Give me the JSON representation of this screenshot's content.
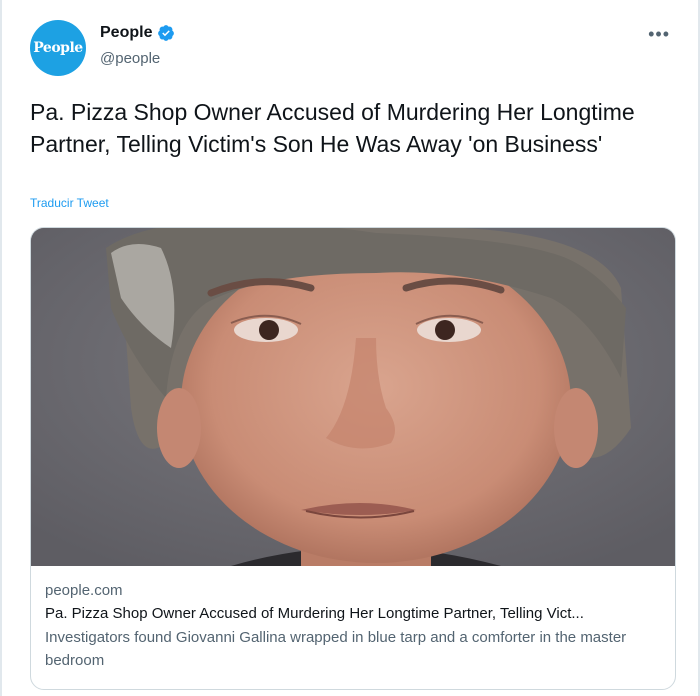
{
  "account": {
    "name": "People",
    "handle": "@people",
    "avatar_text": "People",
    "verified": true
  },
  "more_icon": "more-horizontal-icon",
  "tweet": {
    "text": "Pa. Pizza Shop Owner Accused of Murdering Her Longtime Partner, Telling Victim's Son He Was Away 'on Business'",
    "translate_label": "Traducir Tweet"
  },
  "card": {
    "domain": "people.com",
    "title": "Pa. Pizza Shop Owner Accused of Murdering Her Longtime Partner, Telling Vict...",
    "description": "Investigators found Giovanni Gallina wrapped in blue tarp and a comforter in the master bedroom"
  },
  "colors": {
    "accent": "#1d9bf0",
    "avatar_bg": "#1da1e3",
    "secondary_text": "#536471",
    "border": "#cfd9de"
  }
}
